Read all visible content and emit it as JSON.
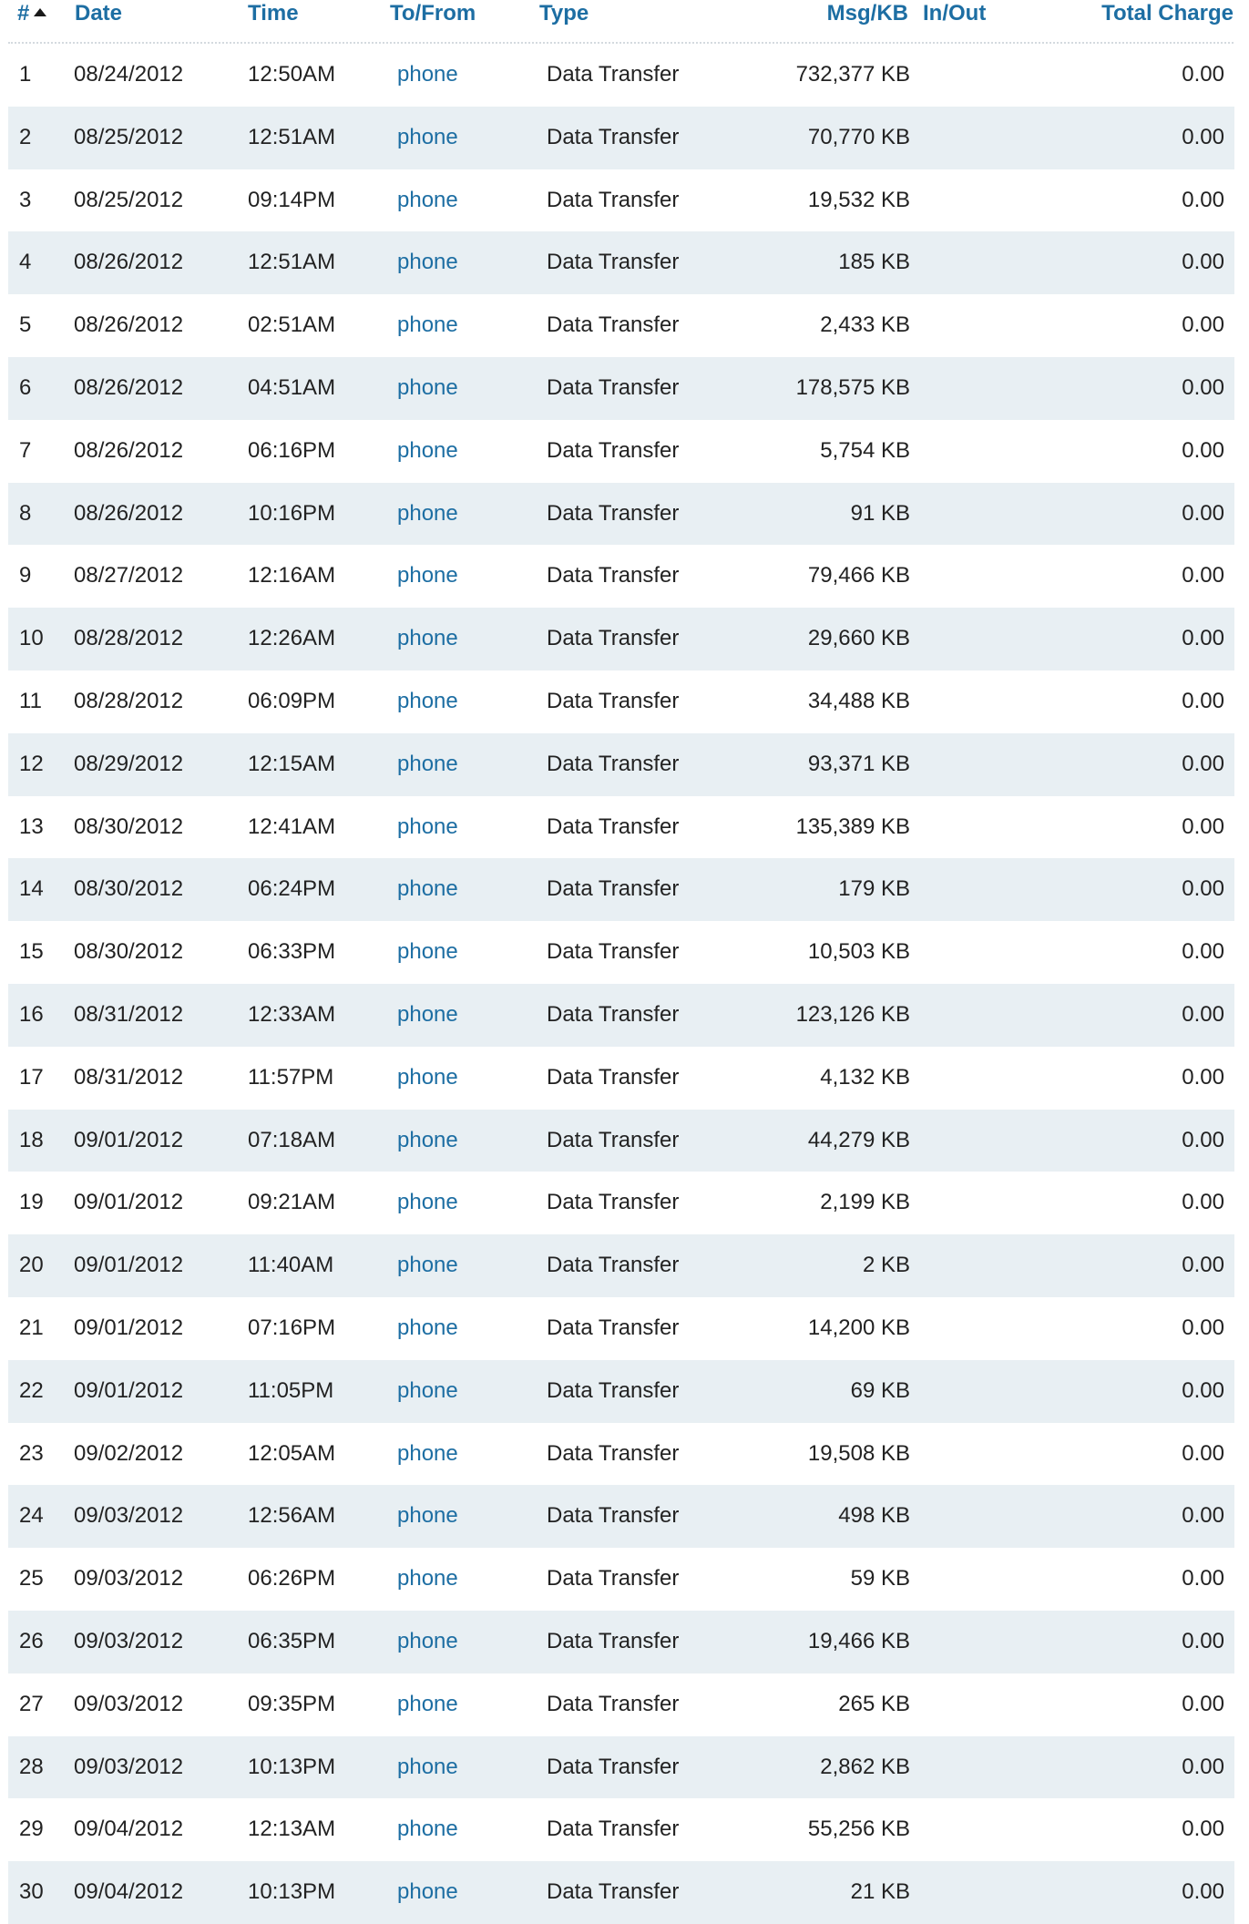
{
  "header": {
    "num": "#",
    "date": "Date",
    "time": "Time",
    "to_from": "To/From",
    "type": "Type",
    "msg_kb": "Msg/KB",
    "in_out": "In/Out",
    "total_charge": "Total Charge",
    "sort_icon": "sort-ascending-icon"
  },
  "colors": {
    "link": "#1d6ea3",
    "row_alt": "#e8eff3",
    "text": "#222222"
  },
  "rows": [
    {
      "num": "1",
      "date": "08/24/2012",
      "time": "12:50AM",
      "to_from": "phone",
      "type": "Data Transfer",
      "msg_kb": "732,377 KB",
      "in_out": "",
      "total": "0.00"
    },
    {
      "num": "2",
      "date": "08/25/2012",
      "time": "12:51AM",
      "to_from": "phone",
      "type": "Data Transfer",
      "msg_kb": "70,770 KB",
      "in_out": "",
      "total": "0.00"
    },
    {
      "num": "3",
      "date": "08/25/2012",
      "time": "09:14PM",
      "to_from": "phone",
      "type": "Data Transfer",
      "msg_kb": "19,532 KB",
      "in_out": "",
      "total": "0.00"
    },
    {
      "num": "4",
      "date": "08/26/2012",
      "time": "12:51AM",
      "to_from": "phone",
      "type": "Data Transfer",
      "msg_kb": "185 KB",
      "in_out": "",
      "total": "0.00"
    },
    {
      "num": "5",
      "date": "08/26/2012",
      "time": "02:51AM",
      "to_from": "phone",
      "type": "Data Transfer",
      "msg_kb": "2,433 KB",
      "in_out": "",
      "total": "0.00"
    },
    {
      "num": "6",
      "date": "08/26/2012",
      "time": "04:51AM",
      "to_from": "phone",
      "type": "Data Transfer",
      "msg_kb": "178,575 KB",
      "in_out": "",
      "total": "0.00"
    },
    {
      "num": "7",
      "date": "08/26/2012",
      "time": "06:16PM",
      "to_from": "phone",
      "type": "Data Transfer",
      "msg_kb": "5,754 KB",
      "in_out": "",
      "total": "0.00"
    },
    {
      "num": "8",
      "date": "08/26/2012",
      "time": "10:16PM",
      "to_from": "phone",
      "type": "Data Transfer",
      "msg_kb": "91 KB",
      "in_out": "",
      "total": "0.00"
    },
    {
      "num": "9",
      "date": "08/27/2012",
      "time": "12:16AM",
      "to_from": "phone",
      "type": "Data Transfer",
      "msg_kb": "79,466 KB",
      "in_out": "",
      "total": "0.00"
    },
    {
      "num": "10",
      "date": "08/28/2012",
      "time": "12:26AM",
      "to_from": "phone",
      "type": "Data Transfer",
      "msg_kb": "29,660 KB",
      "in_out": "",
      "total": "0.00"
    },
    {
      "num": "11",
      "date": "08/28/2012",
      "time": "06:09PM",
      "to_from": "phone",
      "type": "Data Transfer",
      "msg_kb": "34,488 KB",
      "in_out": "",
      "total": "0.00"
    },
    {
      "num": "12",
      "date": "08/29/2012",
      "time": "12:15AM",
      "to_from": "phone",
      "type": "Data Transfer",
      "msg_kb": "93,371 KB",
      "in_out": "",
      "total": "0.00"
    },
    {
      "num": "13",
      "date": "08/30/2012",
      "time": "12:41AM",
      "to_from": "phone",
      "type": "Data Transfer",
      "msg_kb": "135,389 KB",
      "in_out": "",
      "total": "0.00"
    },
    {
      "num": "14",
      "date": "08/30/2012",
      "time": "06:24PM",
      "to_from": "phone",
      "type": "Data Transfer",
      "msg_kb": "179 KB",
      "in_out": "",
      "total": "0.00"
    },
    {
      "num": "15",
      "date": "08/30/2012",
      "time": "06:33PM",
      "to_from": "phone",
      "type": "Data Transfer",
      "msg_kb": "10,503 KB",
      "in_out": "",
      "total": "0.00"
    },
    {
      "num": "16",
      "date": "08/31/2012",
      "time": "12:33AM",
      "to_from": "phone",
      "type": "Data Transfer",
      "msg_kb": "123,126 KB",
      "in_out": "",
      "total": "0.00"
    },
    {
      "num": "17",
      "date": "08/31/2012",
      "time": "11:57PM",
      "to_from": "phone",
      "type": "Data Transfer",
      "msg_kb": "4,132 KB",
      "in_out": "",
      "total": "0.00"
    },
    {
      "num": "18",
      "date": "09/01/2012",
      "time": "07:18AM",
      "to_from": "phone",
      "type": "Data Transfer",
      "msg_kb": "44,279 KB",
      "in_out": "",
      "total": "0.00"
    },
    {
      "num": "19",
      "date": "09/01/2012",
      "time": "09:21AM",
      "to_from": "phone",
      "type": "Data Transfer",
      "msg_kb": "2,199 KB",
      "in_out": "",
      "total": "0.00"
    },
    {
      "num": "20",
      "date": "09/01/2012",
      "time": "11:40AM",
      "to_from": "phone",
      "type": "Data Transfer",
      "msg_kb": "2 KB",
      "in_out": "",
      "total": "0.00"
    },
    {
      "num": "21",
      "date": "09/01/2012",
      "time": "07:16PM",
      "to_from": "phone",
      "type": "Data Transfer",
      "msg_kb": "14,200 KB",
      "in_out": "",
      "total": "0.00"
    },
    {
      "num": "22",
      "date": "09/01/2012",
      "time": "11:05PM",
      "to_from": "phone",
      "type": "Data Transfer",
      "msg_kb": "69 KB",
      "in_out": "",
      "total": "0.00"
    },
    {
      "num": "23",
      "date": "09/02/2012",
      "time": "12:05AM",
      "to_from": "phone",
      "type": "Data Transfer",
      "msg_kb": "19,508 KB",
      "in_out": "",
      "total": "0.00"
    },
    {
      "num": "24",
      "date": "09/03/2012",
      "time": "12:56AM",
      "to_from": "phone",
      "type": "Data Transfer",
      "msg_kb": "498 KB",
      "in_out": "",
      "total": "0.00"
    },
    {
      "num": "25",
      "date": "09/03/2012",
      "time": "06:26PM",
      "to_from": "phone",
      "type": "Data Transfer",
      "msg_kb": "59 KB",
      "in_out": "",
      "total": "0.00"
    },
    {
      "num": "26",
      "date": "09/03/2012",
      "time": "06:35PM",
      "to_from": "phone",
      "type": "Data Transfer",
      "msg_kb": "19,466 KB",
      "in_out": "",
      "total": "0.00"
    },
    {
      "num": "27",
      "date": "09/03/2012",
      "time": "09:35PM",
      "to_from": "phone",
      "type": "Data Transfer",
      "msg_kb": "265 KB",
      "in_out": "",
      "total": "0.00"
    },
    {
      "num": "28",
      "date": "09/03/2012",
      "time": "10:13PM",
      "to_from": "phone",
      "type": "Data Transfer",
      "msg_kb": "2,862 KB",
      "in_out": "",
      "total": "0.00"
    },
    {
      "num": "29",
      "date": "09/04/2012",
      "time": "12:13AM",
      "to_from": "phone",
      "type": "Data Transfer",
      "msg_kb": "55,256 KB",
      "in_out": "",
      "total": "0.00"
    },
    {
      "num": "30",
      "date": "09/04/2012",
      "time": "10:13PM",
      "to_from": "phone",
      "type": "Data Transfer",
      "msg_kb": "21 KB",
      "in_out": "",
      "total": "0.00"
    }
  ]
}
